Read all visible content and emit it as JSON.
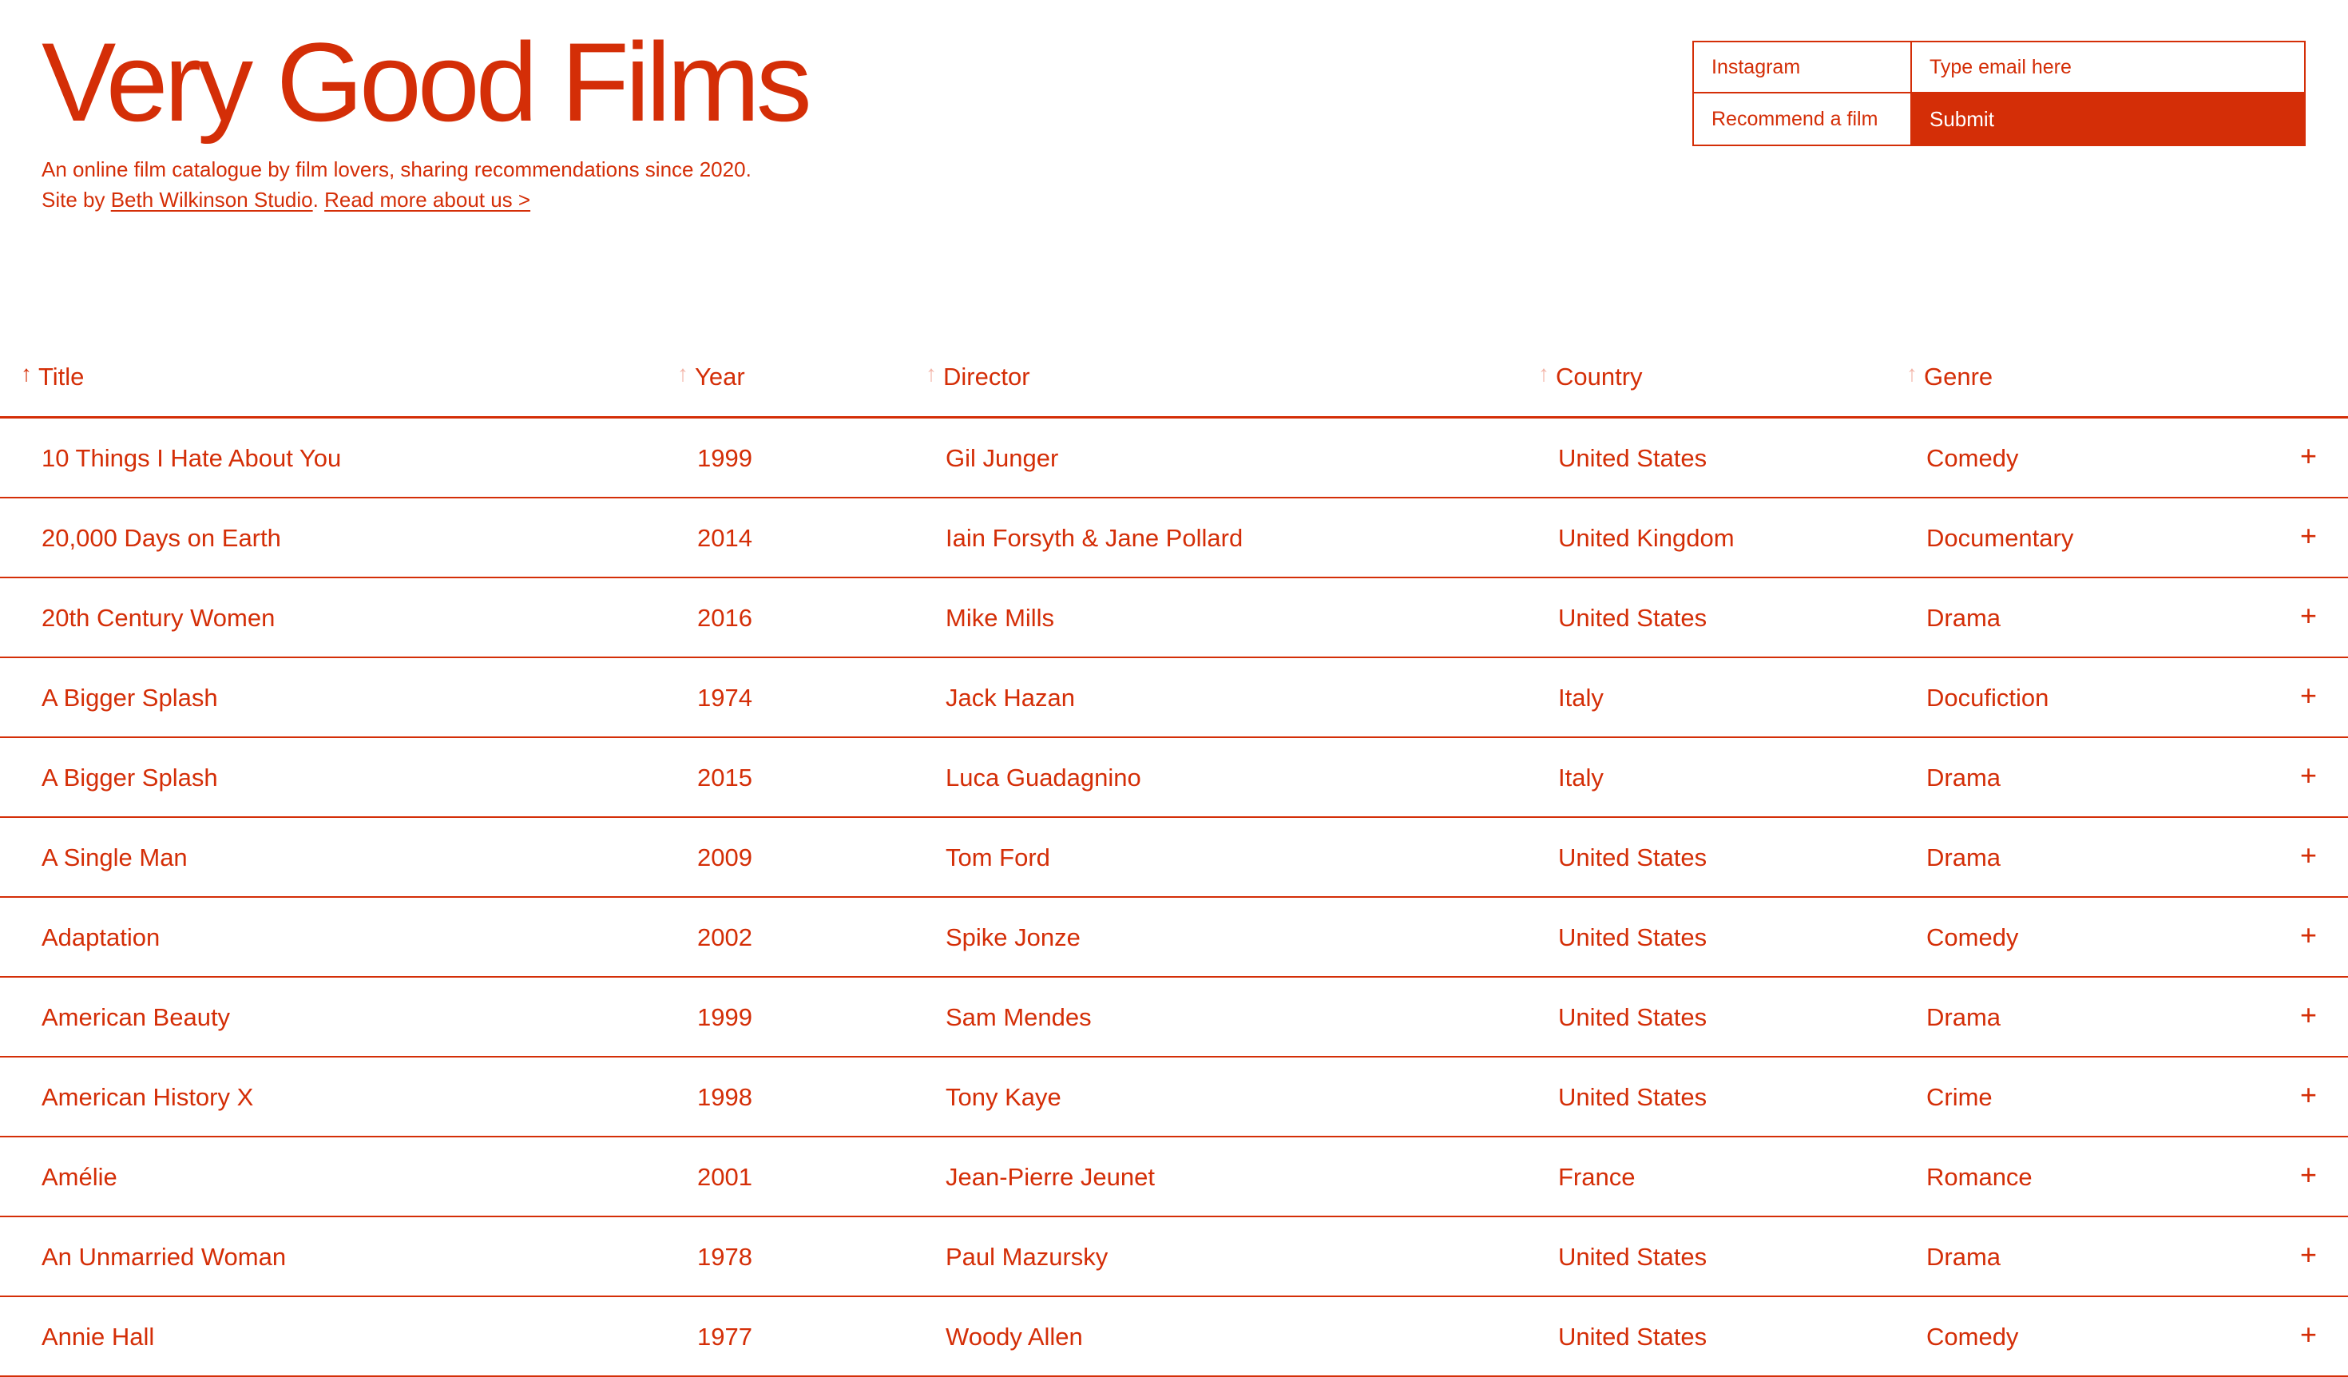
{
  "site": {
    "title": "Very Good Films",
    "tagline_line1": "An online film catalogue by film lovers, sharing recommendations since 2020.",
    "site_by_prefix": "Site by ",
    "studio_link": "Beth Wilkinson Studio",
    "period": ".",
    "about_link": "Read more about us >"
  },
  "form": {
    "instagram_label": "Instagram",
    "recommend_label": "Recommend a film",
    "email_placeholder": "Type email here",
    "submit_label": "Submit"
  },
  "table": {
    "columns": [
      {
        "label": "Title",
        "sort_arrow": "↑",
        "active": true
      },
      {
        "label": "Year",
        "sort_arrow": "↑",
        "active": false
      },
      {
        "label": "Director",
        "sort_arrow": "↑",
        "active": false
      },
      {
        "label": "Country",
        "sort_arrow": "↑",
        "active": false
      },
      {
        "label": "Genre",
        "sort_arrow": "↑",
        "active": false
      }
    ],
    "expand_symbol": "+",
    "rows": [
      {
        "title": "10 Things I Hate About You",
        "year": "1999",
        "director": "Gil Junger",
        "country": "United States",
        "genre": "Comedy"
      },
      {
        "title": "20,000 Days on Earth",
        "year": "2014",
        "director": "Iain Forsyth & Jane Pollard",
        "country": "United Kingdom",
        "genre": "Documentary"
      },
      {
        "title": "20th Century Women",
        "year": "2016",
        "director": "Mike Mills",
        "country": "United States",
        "genre": "Drama"
      },
      {
        "title": "A Bigger Splash",
        "year": "1974",
        "director": "Jack Hazan",
        "country": "Italy",
        "genre": "Docufiction"
      },
      {
        "title": "A Bigger Splash",
        "year": "2015",
        "director": "Luca Guadagnino",
        "country": "Italy",
        "genre": "Drama"
      },
      {
        "title": "A Single Man",
        "year": "2009",
        "director": "Tom Ford",
        "country": "United States",
        "genre": "Drama"
      },
      {
        "title": "Adaptation",
        "year": "2002",
        "director": "Spike Jonze",
        "country": "United States",
        "genre": "Comedy"
      },
      {
        "title": "American Beauty",
        "year": "1999",
        "director": "Sam Mendes",
        "country": "United States",
        "genre": "Drama"
      },
      {
        "title": "American History X",
        "year": "1998",
        "director": "Tony Kaye",
        "country": "United States",
        "genre": "Crime"
      },
      {
        "title": "Amélie",
        "year": "2001",
        "director": "Jean-Pierre Jeunet",
        "country": "France",
        "genre": "Romance"
      },
      {
        "title": "An Unmarried Woman",
        "year": "1978",
        "director": "Paul Mazursky",
        "country": "United States",
        "genre": "Drama"
      },
      {
        "title": "Annie Hall",
        "year": "1977",
        "director": "Woody Allen",
        "country": "United States",
        "genre": "Comedy"
      }
    ]
  },
  "colors": {
    "accent": "#d42e07",
    "faded_arrow": "#f2b3a6",
    "background": "#ffffff"
  }
}
